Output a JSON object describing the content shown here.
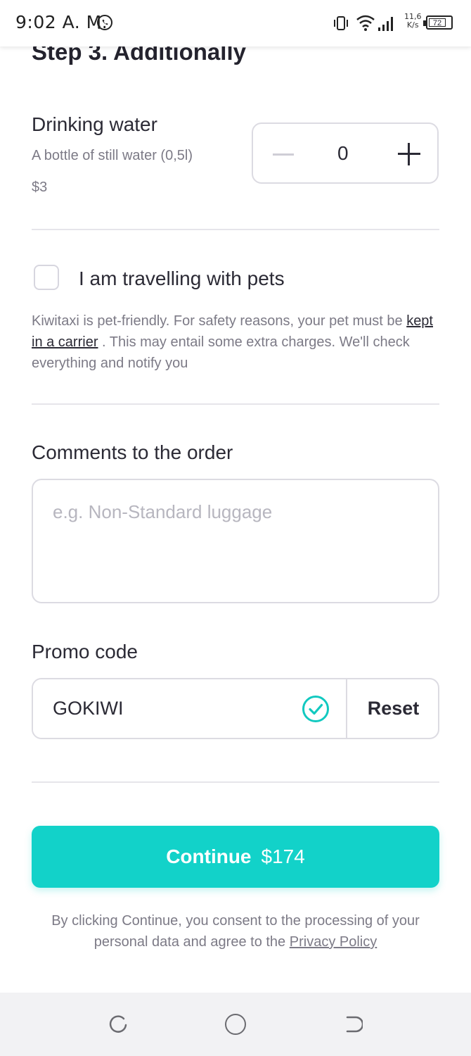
{
  "status_bar": {
    "time": "9:02 A. M.",
    "net_speed_value": "11,6",
    "net_speed_unit": "K/s",
    "battery": "72",
    "icons": [
      "whatsapp-icon",
      "vibrate-icon",
      "wifi-icon",
      "signal-icon",
      "battery-icon"
    ]
  },
  "step": {
    "title": "Step 3. Additionally"
  },
  "water": {
    "title": "Drinking water",
    "description": "A bottle of still water (0,5l)",
    "price": "$3",
    "quantity": "0"
  },
  "pets": {
    "label": "I am travelling with pets",
    "checked": false,
    "info_before": "Kiwitaxi is pet-friendly. For safety reasons, your pet must be ",
    "info_link": "kept in a carrier",
    "info_after": " . This may entail some extra charges. We'll check everything and notify you"
  },
  "comments": {
    "title": "Comments to the order",
    "placeholder": "e.g. Non-Standard luggage",
    "value": ""
  },
  "promo": {
    "title": "Promo code",
    "value": "GOKIWI",
    "reset_label": "Reset"
  },
  "continue": {
    "label": "Continue",
    "price": "$174"
  },
  "consent": {
    "text": "By clicking Continue, you consent to the processing of your personal data and agree to the ",
    "link": "Privacy Policy"
  },
  "colors": {
    "accent": "#12d2c9",
    "text": "#2b2a35",
    "muted": "#7c7a86",
    "border": "#dcdbe2"
  }
}
